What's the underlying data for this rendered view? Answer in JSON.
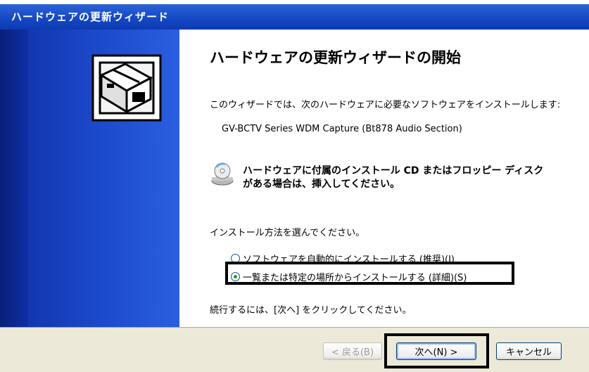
{
  "window": {
    "title": "ハードウェアの更新ウィザード"
  },
  "page": {
    "heading": "ハードウェアの更新ウィザードの開始",
    "intro": "このウィザードでは、次のハードウェアに必要なソフトウェアをインストールします:",
    "device_name": "GV-BCTV Series WDM Capture (Bt878 Audio Section)",
    "cd_prompt": "ハードウェアに付属のインストール CD またはフロッピー ディスクがある場合は、挿入してください。",
    "choose_label": "インストール方法を選んでください。",
    "options": [
      {
        "label": "ソフトウェアを自動的にインストールする (推奨)(I)",
        "selected": false
      },
      {
        "label": "一覧または特定の場所からインストールする (詳細)(S)",
        "selected": true
      }
    ],
    "next_hint": "続行するには、[次へ] をクリックしてください。"
  },
  "buttons": {
    "back": "< 戻る(B)",
    "next": "次へ(N) >",
    "cancel": "キャンセル"
  },
  "colors": {
    "titlebar": "#1447c2",
    "side_panel": "#1c49cb",
    "button_bar": "#ece9d8"
  }
}
